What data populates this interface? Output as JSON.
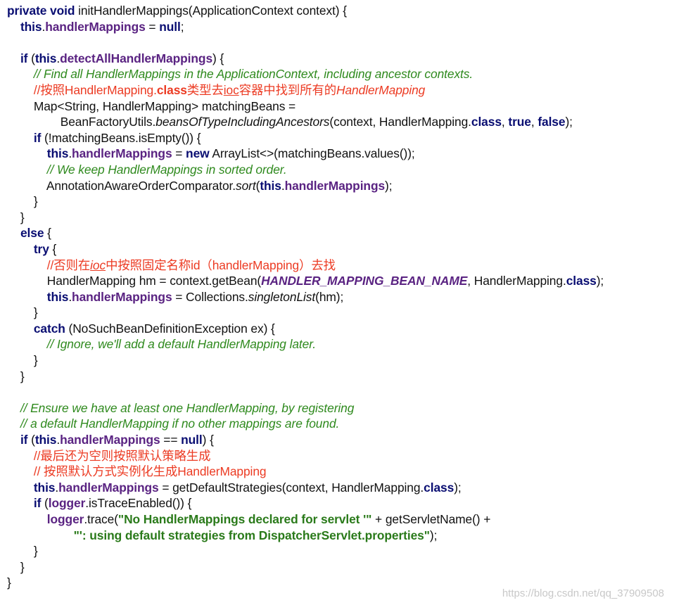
{
  "code": {
    "lines": [
      [
        [
          "kw",
          "private void "
        ],
        [
          "plain",
          "initHandlerMappings(ApplicationContext context) {"
        ]
      ],
      [
        [
          "plain",
          "    "
        ],
        [
          "kw",
          "this"
        ],
        [
          "plain",
          "."
        ],
        [
          "field",
          "handlerMappings"
        ],
        [
          "plain",
          " = "
        ],
        [
          "kw",
          "null"
        ],
        [
          "plain",
          ";"
        ]
      ],
      [
        [
          "plain",
          ""
        ]
      ],
      [
        [
          "plain",
          "    "
        ],
        [
          "kw",
          "if"
        ],
        [
          "plain",
          " ("
        ],
        [
          "kw",
          "this"
        ],
        [
          "plain",
          "."
        ],
        [
          "field",
          "detectAllHandlerMappings"
        ],
        [
          "plain",
          ") {"
        ]
      ],
      [
        [
          "plain",
          "        "
        ],
        [
          "comment",
          "// Find all HandlerMappings in the ApplicationContext, including ancestor contexts."
        ]
      ],
      [
        [
          "plain",
          "        "
        ],
        [
          "note",
          "//按照HandlerMapping."
        ],
        [
          "note-bold",
          "class"
        ],
        [
          "note",
          "类型去"
        ],
        [
          "note-u",
          "ioc"
        ],
        [
          "note",
          "容器中找到所有的"
        ],
        [
          "note-it",
          "HandlerMapping"
        ]
      ],
      [
        [
          "plain",
          "        Map<String, HandlerMapping> matchingBeans ="
        ]
      ],
      [
        [
          "plain",
          "                BeanFactoryUtils."
        ],
        [
          "method-it",
          "beansOfTypeIncludingAncestors"
        ],
        [
          "plain",
          "(context, HandlerMapping."
        ],
        [
          "kw",
          "class"
        ],
        [
          "plain",
          ", "
        ],
        [
          "kw",
          "true"
        ],
        [
          "plain",
          ", "
        ],
        [
          "kw",
          "false"
        ],
        [
          "plain",
          ");"
        ]
      ],
      [
        [
          "plain",
          "        "
        ],
        [
          "kw",
          "if"
        ],
        [
          "plain",
          " (!matchingBeans.isEmpty()) {"
        ]
      ],
      [
        [
          "plain",
          "            "
        ],
        [
          "kw",
          "this"
        ],
        [
          "plain",
          "."
        ],
        [
          "field",
          "handlerMappings"
        ],
        [
          "plain",
          " = "
        ],
        [
          "kw",
          "new"
        ],
        [
          "plain",
          " ArrayList<>(matchingBeans.values());"
        ]
      ],
      [
        [
          "plain",
          "            "
        ],
        [
          "comment",
          "// We keep HandlerMappings in sorted order."
        ]
      ],
      [
        [
          "plain",
          "            AnnotationAwareOrderComparator."
        ],
        [
          "method-it",
          "sort"
        ],
        [
          "plain",
          "("
        ],
        [
          "kw",
          "this"
        ],
        [
          "plain",
          "."
        ],
        [
          "field",
          "handlerMappings"
        ],
        [
          "plain",
          ");"
        ]
      ],
      [
        [
          "plain",
          "        }"
        ]
      ],
      [
        [
          "plain",
          "    }"
        ]
      ],
      [
        [
          "plain",
          "    "
        ],
        [
          "kw",
          "else"
        ],
        [
          "plain",
          " {"
        ]
      ],
      [
        [
          "plain",
          "        "
        ],
        [
          "kw",
          "try"
        ],
        [
          "plain",
          " {"
        ]
      ],
      [
        [
          "plain",
          "            "
        ],
        [
          "note",
          "//否则在"
        ],
        [
          "note-u-it",
          "ioc"
        ],
        [
          "note",
          "中按照固定名称id（handlerMapping）去找"
        ]
      ],
      [
        [
          "plain",
          "            HandlerMapping hm = context.getBean("
        ],
        [
          "constant",
          "HANDLER_MAPPING_BEAN_NAME"
        ],
        [
          "plain",
          ", HandlerMapping."
        ],
        [
          "kw",
          "class"
        ],
        [
          "plain",
          ");"
        ]
      ],
      [
        [
          "plain",
          "            "
        ],
        [
          "kw",
          "this"
        ],
        [
          "plain",
          "."
        ],
        [
          "field",
          "handlerMappings"
        ],
        [
          "plain",
          " = Collections."
        ],
        [
          "method-it",
          "singletonList"
        ],
        [
          "plain",
          "(hm);"
        ]
      ],
      [
        [
          "plain",
          "        }"
        ]
      ],
      [
        [
          "plain",
          "        "
        ],
        [
          "kw",
          "catch"
        ],
        [
          "plain",
          " (NoSuchBeanDefinitionException ex) {"
        ]
      ],
      [
        [
          "plain",
          "            "
        ],
        [
          "comment",
          "// Ignore, we'll add a default HandlerMapping later."
        ]
      ],
      [
        [
          "plain",
          "        }"
        ]
      ],
      [
        [
          "plain",
          "    }"
        ]
      ],
      [
        [
          "plain",
          ""
        ]
      ],
      [
        [
          "plain",
          "    "
        ],
        [
          "comment",
          "// Ensure we have at least one HandlerMapping, by registering"
        ]
      ],
      [
        [
          "plain",
          "    "
        ],
        [
          "comment",
          "// a default HandlerMapping if no other mappings are found."
        ]
      ],
      [
        [
          "plain",
          "    "
        ],
        [
          "kw",
          "if"
        ],
        [
          "plain",
          " ("
        ],
        [
          "kw",
          "this"
        ],
        [
          "plain",
          "."
        ],
        [
          "field",
          "handlerMappings"
        ],
        [
          "plain",
          " == "
        ],
        [
          "kw",
          "null"
        ],
        [
          "plain",
          ") {"
        ]
      ],
      [
        [
          "plain",
          "        "
        ],
        [
          "note",
          "//最后还为空则按照默认策略生成"
        ]
      ],
      [
        [
          "plain",
          "        "
        ],
        [
          "note",
          "// 按照默认方式实例化生成HandlerMapping"
        ]
      ],
      [
        [
          "plain",
          "        "
        ],
        [
          "kw",
          "this"
        ],
        [
          "plain",
          "."
        ],
        [
          "field",
          "handlerMappings"
        ],
        [
          "plain",
          " = getDefaultStrategies(context, HandlerMapping."
        ],
        [
          "kw",
          "class"
        ],
        [
          "plain",
          ");"
        ]
      ],
      [
        [
          "plain",
          "        "
        ],
        [
          "kw",
          "if"
        ],
        [
          "plain",
          " ("
        ],
        [
          "field",
          "logger"
        ],
        [
          "plain",
          ".isTraceEnabled()) {"
        ]
      ],
      [
        [
          "plain",
          "            "
        ],
        [
          "field",
          "logger"
        ],
        [
          "plain",
          ".trace("
        ],
        [
          "str",
          "\"No HandlerMappings declared for servlet '\""
        ],
        [
          "plain",
          " + getServletName() +"
        ]
      ],
      [
        [
          "plain",
          "                    "
        ],
        [
          "str",
          "\"': using default strategies from DispatcherServlet.properties\""
        ],
        [
          "plain",
          ");"
        ]
      ],
      [
        [
          "plain",
          "        }"
        ]
      ],
      [
        [
          "plain",
          "    }"
        ]
      ],
      [
        [
          "plain",
          "}"
        ]
      ]
    ]
  },
  "watermark": "https://blog.csdn.net/qq_37909508",
  "colors": {
    "keyword": "#0a0e72",
    "field": "#5a2382",
    "comment": "#2f8a1e",
    "note": "#ec3b23",
    "string": "#2a7a1a"
  }
}
